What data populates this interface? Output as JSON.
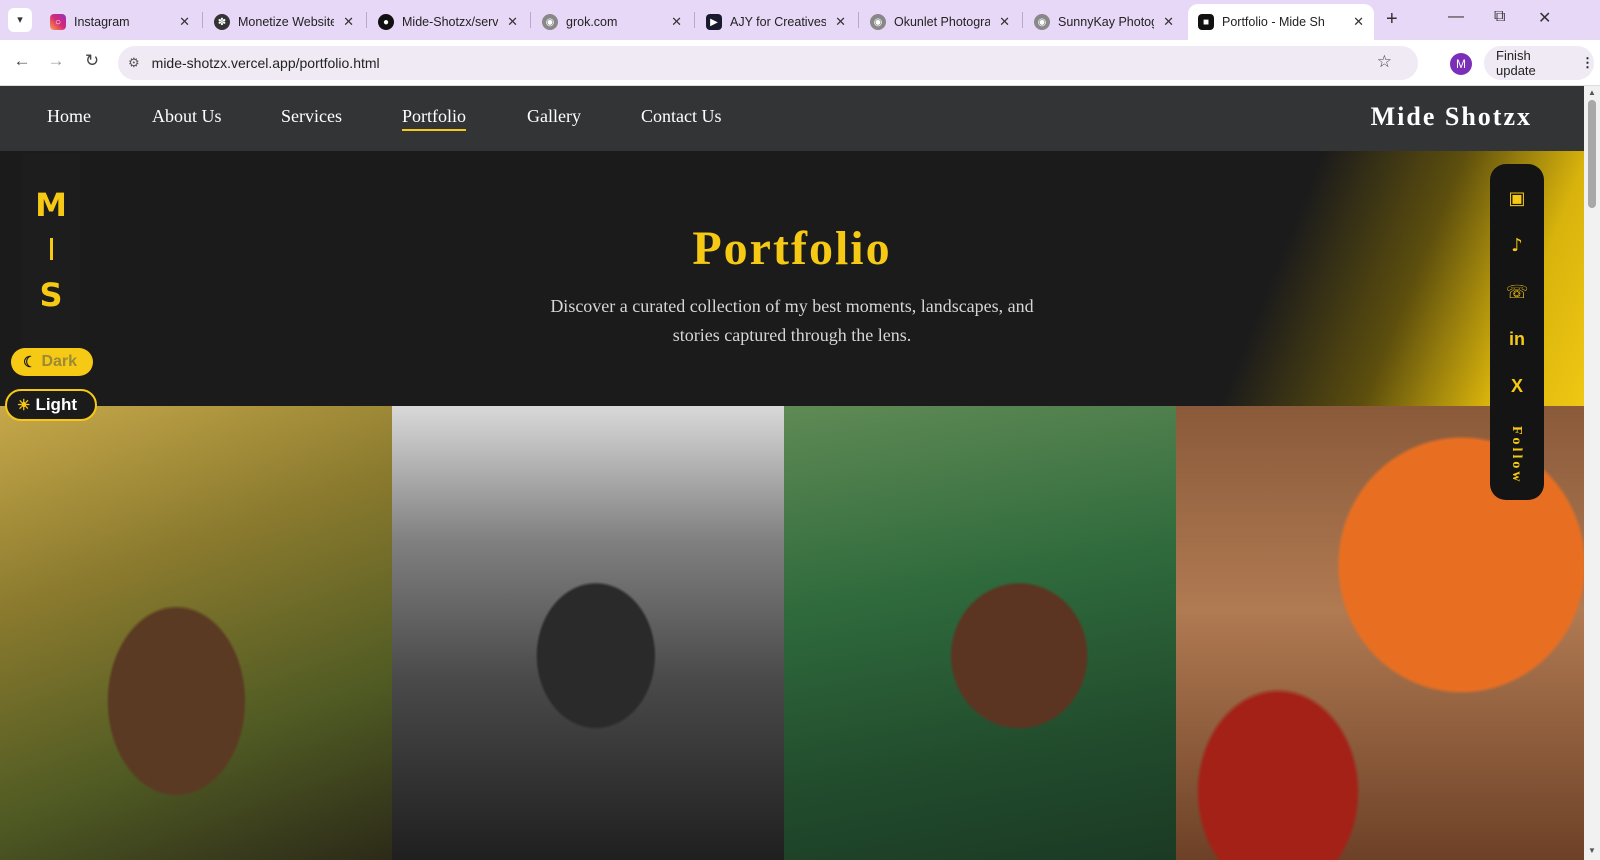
{
  "browser": {
    "tabs": [
      {
        "title": "Instagram",
        "active": false
      },
      {
        "title": "Monetize Website",
        "active": false
      },
      {
        "title": "Mide-Shotzx/servi",
        "active": false
      },
      {
        "title": "grok.com",
        "active": false
      },
      {
        "title": "AJY for Creatives -",
        "active": false
      },
      {
        "title": "Okunlet Photogra",
        "active": false
      },
      {
        "title": "SunnyKay Photog",
        "active": false
      },
      {
        "title": "Portfolio - Mide Sh",
        "active": true
      }
    ],
    "url": "mide-shotzx.vercel.app/portfolio.html",
    "profile_initial": "M",
    "finish_update": "Finish update"
  },
  "site": {
    "nav": [
      "Home",
      "About Us",
      "Services",
      "Portfolio",
      "Gallery",
      "Contact Us"
    ],
    "active_nav": "Portfolio",
    "brand": "Mide Shotzx",
    "monogram": {
      "top": "M",
      "bottom": "S"
    },
    "theme": {
      "dark_label": "Dark",
      "light_label": "Light"
    },
    "hero": {
      "title": "Portfolio",
      "description": "Discover a curated collection of my best moments, landscapes, and stories captured through the lens."
    },
    "social": {
      "icons": [
        "instagram-icon",
        "tiktok-icon",
        "whatsapp-icon",
        "linkedin-icon",
        "x-icon"
      ],
      "follow_label": "Follow"
    },
    "accent_color": "#f6c915",
    "photos": [
      "portrait-woman-palm",
      "portrait-man-bw",
      "portrait-woman-coral-beads",
      "portrait-umbrella"
    ]
  }
}
